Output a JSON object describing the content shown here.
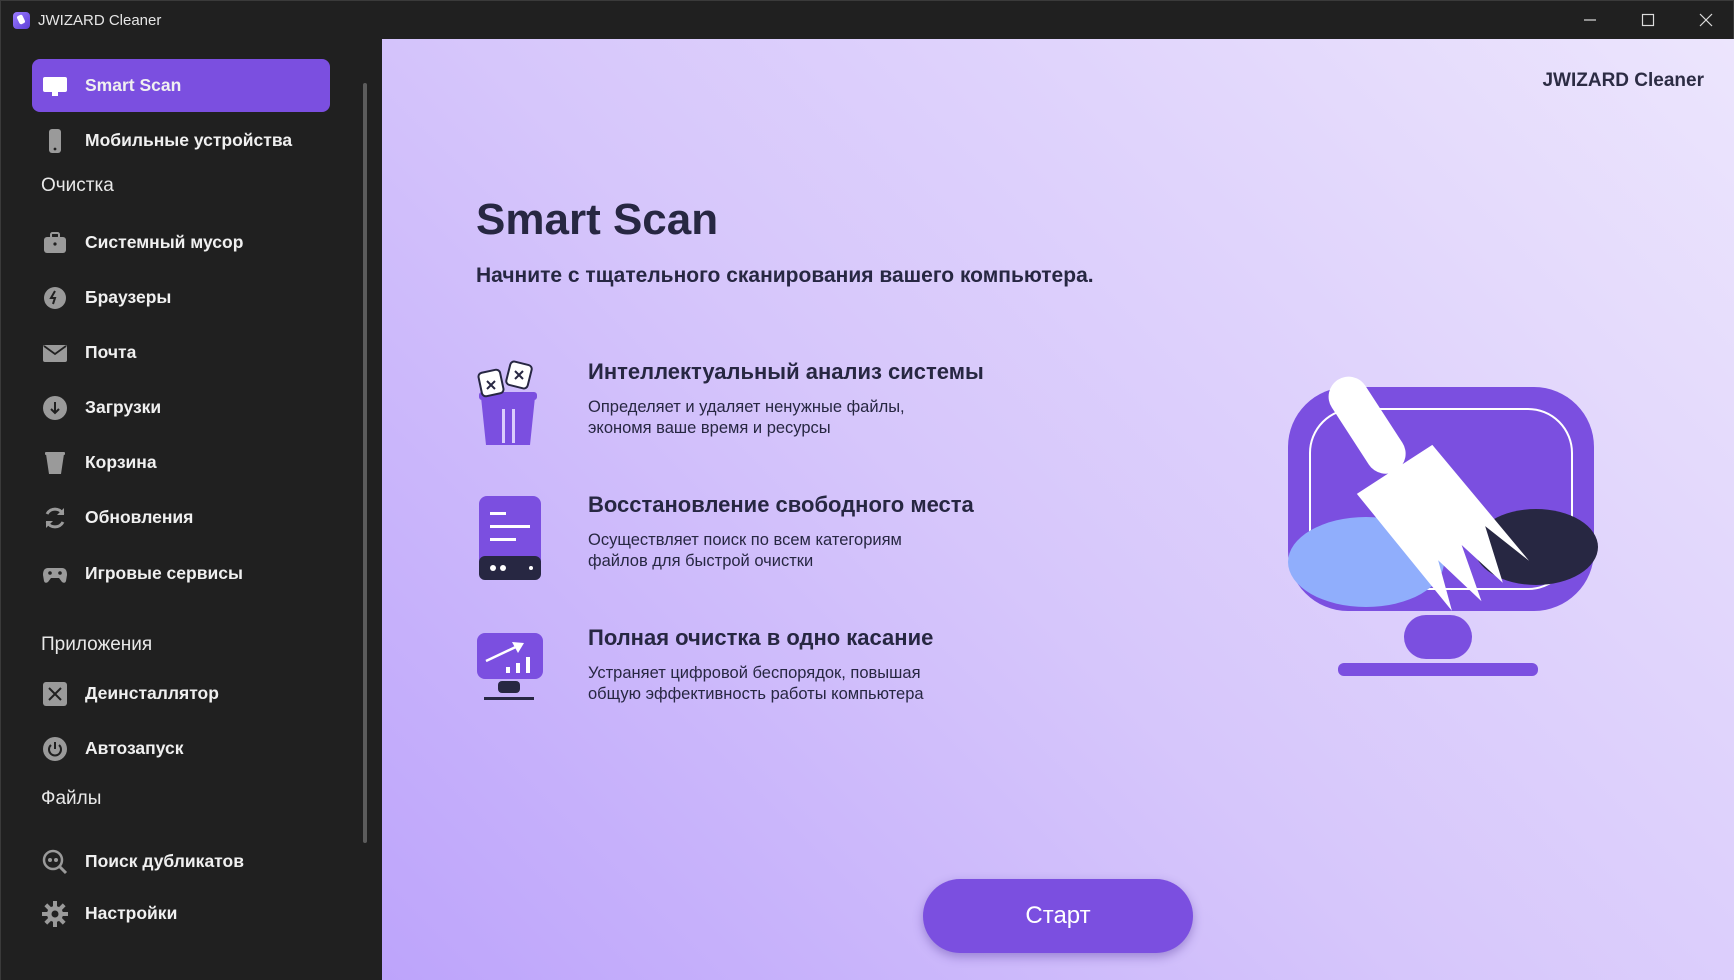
{
  "window": {
    "title": "JWIZARD Cleaner"
  },
  "sidebar": {
    "items": [
      {
        "label": "Smart Scan",
        "icon": "monitor-icon",
        "active": true
      },
      {
        "label": "Мобильные устройства",
        "icon": "smartphone-icon"
      }
    ],
    "sections": [
      {
        "label": "Очистка",
        "items": [
          {
            "label": "Системный мусор",
            "icon": "briefcase-icon"
          },
          {
            "label": "Браузеры",
            "icon": "browser-icon"
          },
          {
            "label": "Почта",
            "icon": "mail-icon"
          },
          {
            "label": "Загрузки",
            "icon": "download-icon"
          },
          {
            "label": "Корзина",
            "icon": "trash-icon"
          },
          {
            "label": "Обновления",
            "icon": "refresh-icon"
          },
          {
            "label": "Игровые сервисы",
            "icon": "gamepad-icon"
          }
        ]
      },
      {
        "label": "Приложения",
        "items": [
          {
            "label": "Деинсталлятор",
            "icon": "uninstall-icon"
          },
          {
            "label": "Автозапуск",
            "icon": "power-icon"
          }
        ]
      },
      {
        "label": "Файлы",
        "items": [
          {
            "label": "Поиск дубликатов",
            "icon": "duplicate-search-icon"
          },
          {
            "label": "Настройки",
            "icon": "gear-icon"
          }
        ]
      }
    ]
  },
  "main": {
    "brand": "JWIZARD Cleaner",
    "title": "Smart Scan",
    "subtitle": "Начните с тщательного сканирования вашего компьютера.",
    "features": [
      {
        "title": "Интеллектуальный анализ системы",
        "desc1": "Определяет и удаляет ненужные файлы,",
        "desc2": "экономя ваше время и ресурсы",
        "icon": "trash-files-icon"
      },
      {
        "title": "Восстановление свободного места",
        "desc1": "Осуществляет поиск по всем категориям",
        "desc2": "файлов для быстрой очистки",
        "icon": "storage-drive-icon"
      },
      {
        "title": "Полная очистка в одно касание",
        "desc1": "Устраняет цифровой беспорядок, повышая",
        "desc2": "общую эффективность работы компьютера",
        "icon": "performance-chart-icon"
      }
    ],
    "start_label": "Старт"
  },
  "colors": {
    "accent": "#7b4fe0",
    "sidebar_bg": "#202020",
    "text_dark": "#272742"
  }
}
